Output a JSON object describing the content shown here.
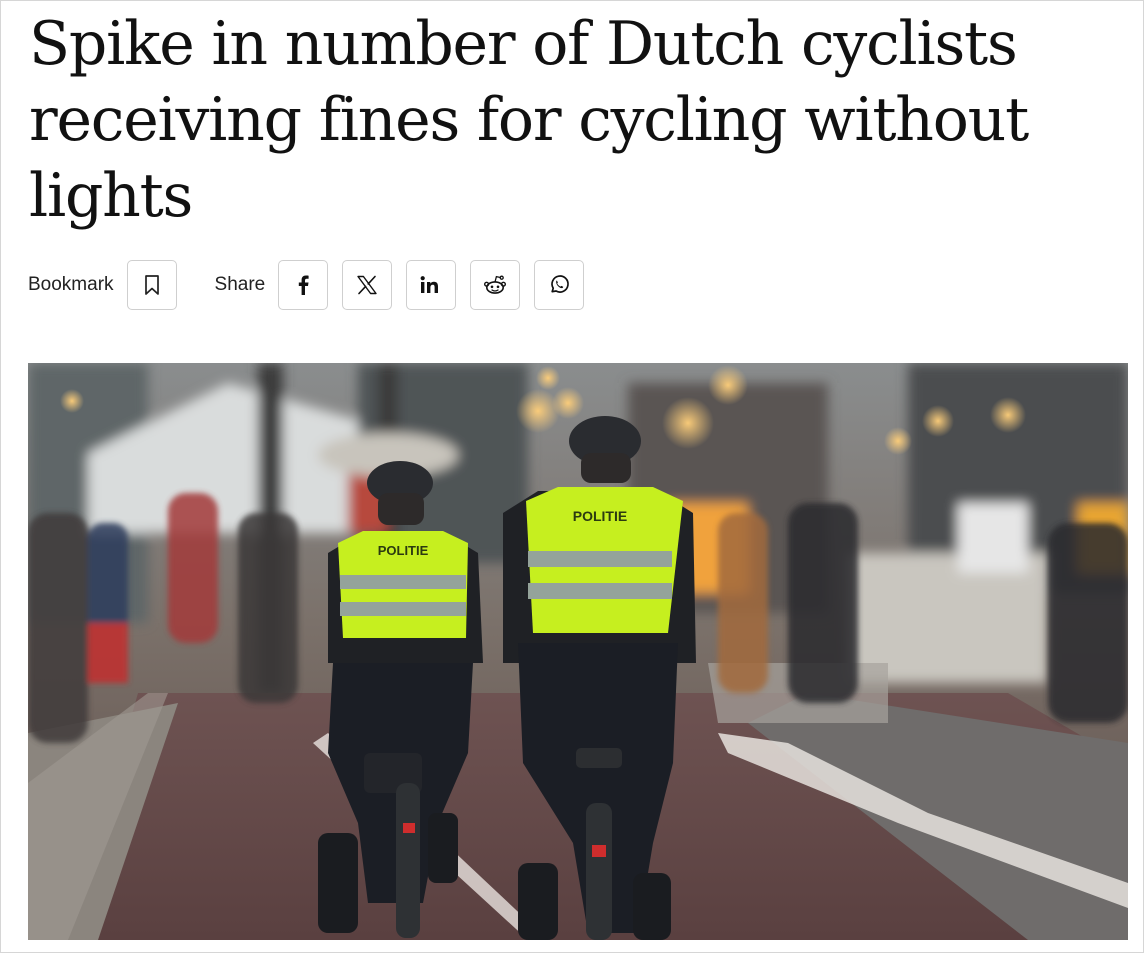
{
  "article": {
    "headline": "Spike in number of Dutch cyclists receiving fines for cycling without lights"
  },
  "share_bar": {
    "bookmark_label": "Bookmark",
    "share_label": "Share",
    "icons": [
      "bookmark-icon",
      "facebook-icon",
      "x-icon",
      "linkedin-icon",
      "reddit-icon",
      "whatsapp-icon"
    ]
  },
  "hero_image": {
    "vest_text": "POLITIE",
    "vest_color": "#c6ef1f"
  }
}
